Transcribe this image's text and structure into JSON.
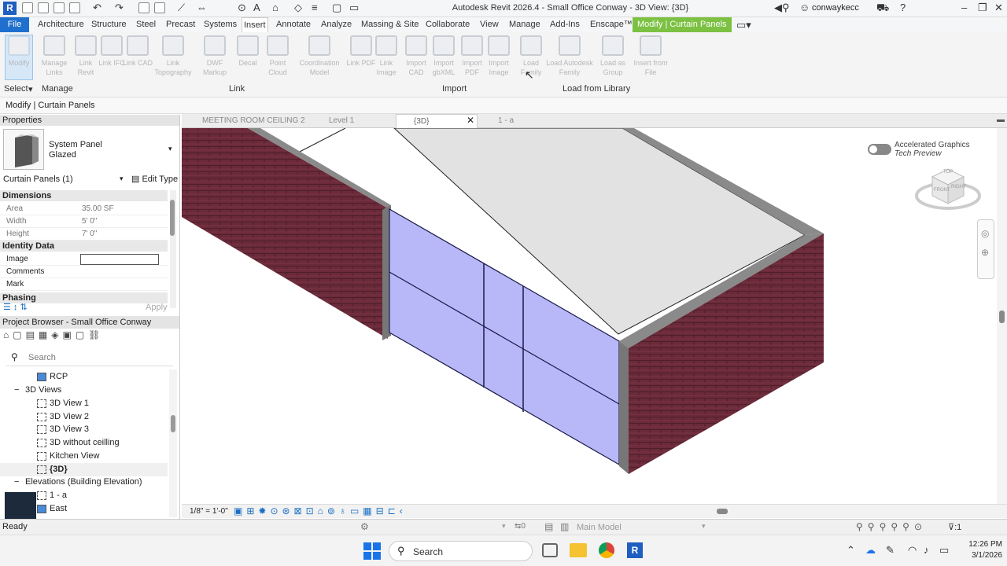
{
  "titlebar": {
    "title": "Autodesk Revit 2026.4 - Small Office Conway - 3D View: {3D}",
    "user": "conwaykecc",
    "logo": "R"
  },
  "menu": [
    "File",
    "Architecture",
    "Structure",
    "Steel",
    "Precast",
    "Systems",
    "Insert",
    "Annotate",
    "Analyze",
    "Massing & Site",
    "Collaborate",
    "View",
    "Manage",
    "Add-Ins",
    "Enscape™",
    "Modify | Curtain Panels"
  ],
  "ribbon": {
    "modify": "Modify",
    "buttons": [
      "Manage Links",
      "Link Revit",
      "Link IFC",
      "Link CAD",
      "Link Topography",
      "DWF Markup",
      "Decal",
      "Point Cloud",
      "Coordination Model",
      "Link PDF",
      "Link Image",
      "Import CAD",
      "Import gbXML",
      "Import PDF",
      "Import Image",
      "Load Family",
      "Load Autodesk Family",
      "Load as Group",
      "Insert from File"
    ],
    "panels": {
      "select": "Select",
      "manage": "Manage",
      "link": "Link",
      "import": "Import",
      "library": "Load from Library"
    }
  },
  "optbar": {
    "mode": "Modify | Curtain Panels"
  },
  "properties": {
    "header": "Properties",
    "type_name": "System Panel",
    "type_sub": "Glazed",
    "selector": "Curtain Panels (1)",
    "edit_type": "Edit Type",
    "dimensions": "Dimensions",
    "rows": [
      {
        "k": "Area",
        "v": "35.00 SF"
      },
      {
        "k": "Width",
        "v": "5'  0\""
      },
      {
        "k": "Height",
        "v": "7'  0\""
      }
    ],
    "identity": "Identity Data",
    "id_rows": [
      {
        "k": "Image",
        "v": ""
      },
      {
        "k": "Comments",
        "v": ""
      },
      {
        "k": "Mark",
        "v": ""
      }
    ],
    "phasing": "Phasing",
    "apply": "Apply"
  },
  "browser": {
    "header": "Project Browser - Small Office Conway",
    "search_placeholder": "Search",
    "items": [
      "RCP",
      "3D Views",
      "3D View 1",
      "3D View 2",
      "3D View 3",
      "3D without ceilling",
      "Kitchen View",
      "{3D}",
      "Elevations (Building Elevation)",
      "1 - a",
      "East"
    ]
  },
  "view_tabs": [
    "MEETING ROOM CEILING 2",
    "Level 1",
    "{3D}",
    "1 - a"
  ],
  "canvas": {
    "graphics_title": "Accelerated Graphics",
    "graphics_sub": "Tech Preview",
    "cube_top": "TOP",
    "cube_front": "FRONT",
    "cube_right": "RIGHT"
  },
  "view_status": {
    "scale": "1/8\" = 1'-0\""
  },
  "statusbar": {
    "ready": "Ready",
    "zero": "0",
    "model": "Main Model",
    "filter": ":1"
  },
  "taskbar": {
    "search": "Search",
    "time": "12:26 PM",
    "date": "3/1/2026"
  },
  "colors": {
    "file_tab": "#1f6fce",
    "context_tab": "#7cc142",
    "brick": "#6b2a3a",
    "glass": "#b8b8f8",
    "wall_cap": "#8a8a8a"
  }
}
